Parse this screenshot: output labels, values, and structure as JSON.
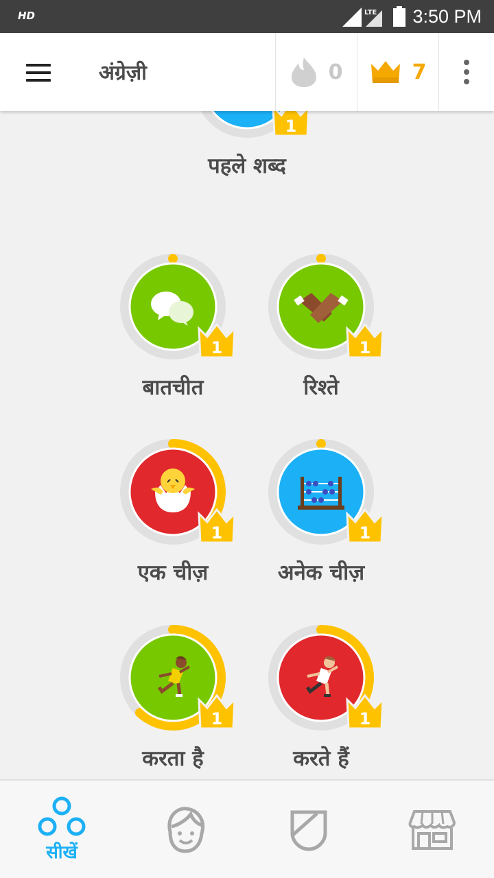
{
  "status_bar": {
    "left_label": "HD",
    "network_label": "LTE",
    "time": "3:50 PM"
  },
  "app_bar": {
    "course_title": "अंग्रेज़ी",
    "streak_count": "0",
    "crown_count": "7"
  },
  "skills": [
    {
      "id": "first-words",
      "label": "पहले शब्द",
      "crown_level": "1",
      "progress": 0.3,
      "color": "#1cb0f6"
    },
    {
      "id": "conversation",
      "label": "बातचीत",
      "crown_level": "1",
      "progress": 0.0,
      "color": "#78c800"
    },
    {
      "id": "relationships",
      "label": "रिश्ते",
      "crown_level": "1",
      "progress": 0.0,
      "color": "#78c800"
    },
    {
      "id": "one-thing",
      "label": "एक चीज़",
      "crown_level": "1",
      "progress": 0.35,
      "color": "#e0282d"
    },
    {
      "id": "many-things",
      "label": "अनेक चीज़",
      "crown_level": "1",
      "progress": 0.0,
      "color": "#1cb0f6"
    },
    {
      "id": "does",
      "label": "करता है",
      "crown_level": "1",
      "progress": 0.62,
      "color": "#78c800"
    },
    {
      "id": "do",
      "label": "करते हैं",
      "crown_level": "1",
      "progress": 0.32,
      "color": "#e0282d"
    }
  ],
  "bottom_nav": {
    "learn_label": "सीखें"
  },
  "colors": {
    "accent": "#1cb0f6",
    "crown": "#f5a800",
    "progress": "#ffc200",
    "ring": "#e0e0e0"
  }
}
